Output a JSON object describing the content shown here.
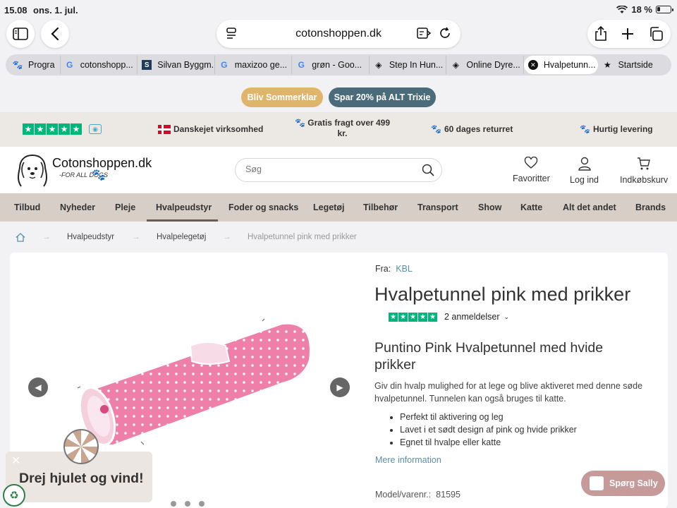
{
  "status": {
    "time": "15.08",
    "date": "ons. 1. jul.",
    "battery": "18 %"
  },
  "browser": {
    "url": "cotonshoppen.dk",
    "tabs": [
      {
        "label": "Progra",
        "icon": "paw-icon"
      },
      {
        "label": "cotonshopp...",
        "icon": "google-icon"
      },
      {
        "label": "Silvan Byggm...",
        "icon": "silvan-icon"
      },
      {
        "label": "maxizoo ge...",
        "icon": "google-icon"
      },
      {
        "label": "grøn - Goo...",
        "icon": "google-icon"
      },
      {
        "label": "Step In Hun...",
        "icon": "flame-icon"
      },
      {
        "label": "Online Dyre...",
        "icon": "flame-icon"
      },
      {
        "label": "Hvalpetunn...",
        "icon": "close-icon"
      },
      {
        "label": "Startside",
        "icon": "star-icon"
      }
    ]
  },
  "promo": {
    "left": "Bliv Sommerklar",
    "right": "Spar 20% på ALT Trixie",
    "left_color": "#dfb56b",
    "right_color": "#4a6b7a"
  },
  "usp": {
    "danish": "Danskejet virksomhed",
    "shipping_line1": "Gratis fragt over 499",
    "shipping_line2": "kr.",
    "returns": "60 dages returret",
    "delivery": "Hurtig levering"
  },
  "header": {
    "logo": "Cotonshoppen.dk",
    "logo_sub": "-FOR ALL DOGS",
    "search_placeholder": "Søg",
    "favorites": "Favoritter",
    "login": "Log ind",
    "cart": "Indkøbskurv"
  },
  "nav": [
    "Tilbud",
    "Nyheder",
    "Pleje",
    "Hvalpeudstyr",
    "Foder og snacks",
    "Legetøj",
    "Tilbehør",
    "Transport",
    "Show",
    "Katte",
    "Alt det andet",
    "Brands"
  ],
  "breadcrumb": {
    "level1": "Hvalpeudstyr",
    "level2": "Hvalpelegetøj",
    "current": "Hvalpetunnel pink med prikker"
  },
  "product": {
    "brand_prefix": "Fra:",
    "brand": "KBL",
    "title": "Hvalpetunnel pink med prikker",
    "reviews": "2 anmeldelser",
    "subtitle": "Puntino Pink Hvalpetunnel med hvide prikker",
    "description": "Giv din hvalp mulighed for at lege og blive aktiveret med denne søde hvalpetunnel. Tunnelen kan også bruges til katte.",
    "bullets": [
      "Perfekt til aktivering og leg",
      "Lavet i et sødt design af pink og hvide prikker",
      "Egnet til hvalpe eller katte"
    ],
    "more_info": "Mere information",
    "model_label": "Model/varenr.:",
    "model_number": "81595"
  },
  "widgets": {
    "wheel_text": "Drej hjulet og vind!",
    "chat": "Spørg Sally"
  },
  "colors": {
    "trustpilot": "#00b67a",
    "nav_bg": "#d7cec8",
    "link": "#5a8fa8",
    "tunnel_pink": "#ee7fa8"
  }
}
